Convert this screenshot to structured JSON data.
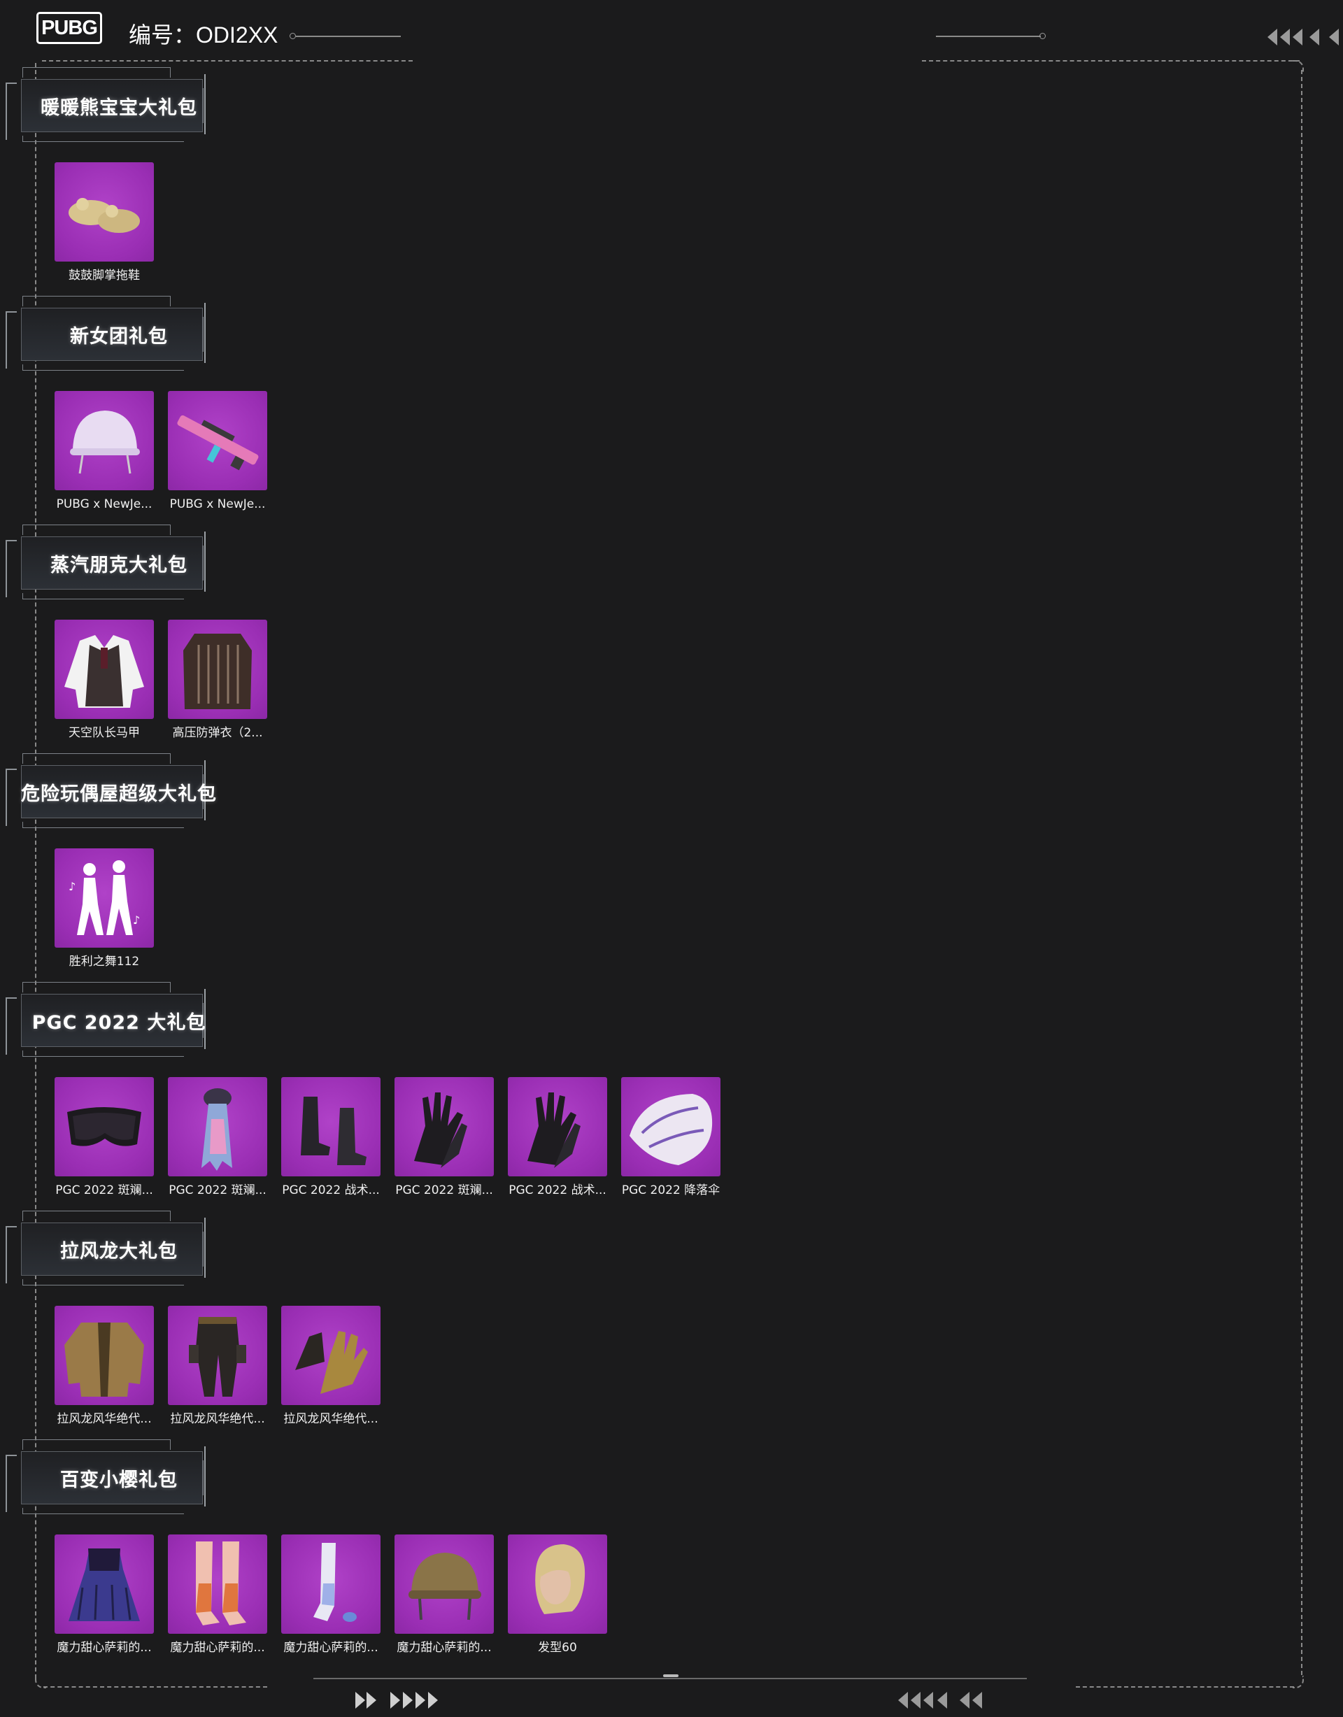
{
  "header": {
    "logo_text": "PUBG",
    "serial_label": "编号：",
    "serial_value": "ODI2XX"
  },
  "sections": [
    {
      "title": "暖暖熊宝宝大礼包",
      "items": [
        {
          "label": "鼓鼓脚掌拖鞋",
          "icon": "slippers-icon"
        }
      ]
    },
    {
      "title": "新女团礼包",
      "items": [
        {
          "label": "PUBG x NewJe...",
          "icon": "helmet-icon"
        },
        {
          "label": "PUBG x NewJe...",
          "icon": "rifle-icon"
        }
      ]
    },
    {
      "title": "蒸汽朋克大礼包",
      "items": [
        {
          "label": "天空队长马甲",
          "icon": "vest-shirt-icon"
        },
        {
          "label": "高压防弹衣（2...",
          "icon": "armor-vest-icon"
        }
      ]
    },
    {
      "title": "危险玩偶屋超级大礼包",
      "items": [
        {
          "label": "胜利之舞112",
          "icon": "dance-emote-icon"
        }
      ]
    },
    {
      "title": "PGC 2022 大礼包",
      "items": [
        {
          "label": "PGC 2022 斑斓...",
          "icon": "goggles-icon"
        },
        {
          "label": "PGC 2022 斑斓...",
          "icon": "scarf-icon"
        },
        {
          "label": "PGC 2022 战术...",
          "icon": "boots-icon"
        },
        {
          "label": "PGC 2022 斑斓...",
          "icon": "gloves-icon"
        },
        {
          "label": "PGC 2022 战术...",
          "icon": "gloves-icon"
        },
        {
          "label": "PGC 2022 降落伞",
          "icon": "parachute-icon"
        }
      ]
    },
    {
      "title": "拉风龙大礼包",
      "items": [
        {
          "label": "拉风龙风华绝代...",
          "icon": "jacket-icon"
        },
        {
          "label": "拉风龙风华绝代...",
          "icon": "pants-icon"
        },
        {
          "label": "拉风龙风华绝代...",
          "icon": "gold-gloves-icon"
        }
      ]
    },
    {
      "title": "百变小樱礼包",
      "items": [
        {
          "label": "魔力甜心萨莉的...",
          "icon": "dress-icon"
        },
        {
          "label": "魔力甜心萨莉的...",
          "icon": "stockings-icon"
        },
        {
          "label": "魔力甜心萨莉的...",
          "icon": "socks-icon"
        },
        {
          "label": "魔力甜心萨莉的...",
          "icon": "gold-helmet-icon"
        },
        {
          "label": "发型60",
          "icon": "hairstyle-icon"
        }
      ]
    }
  ]
}
